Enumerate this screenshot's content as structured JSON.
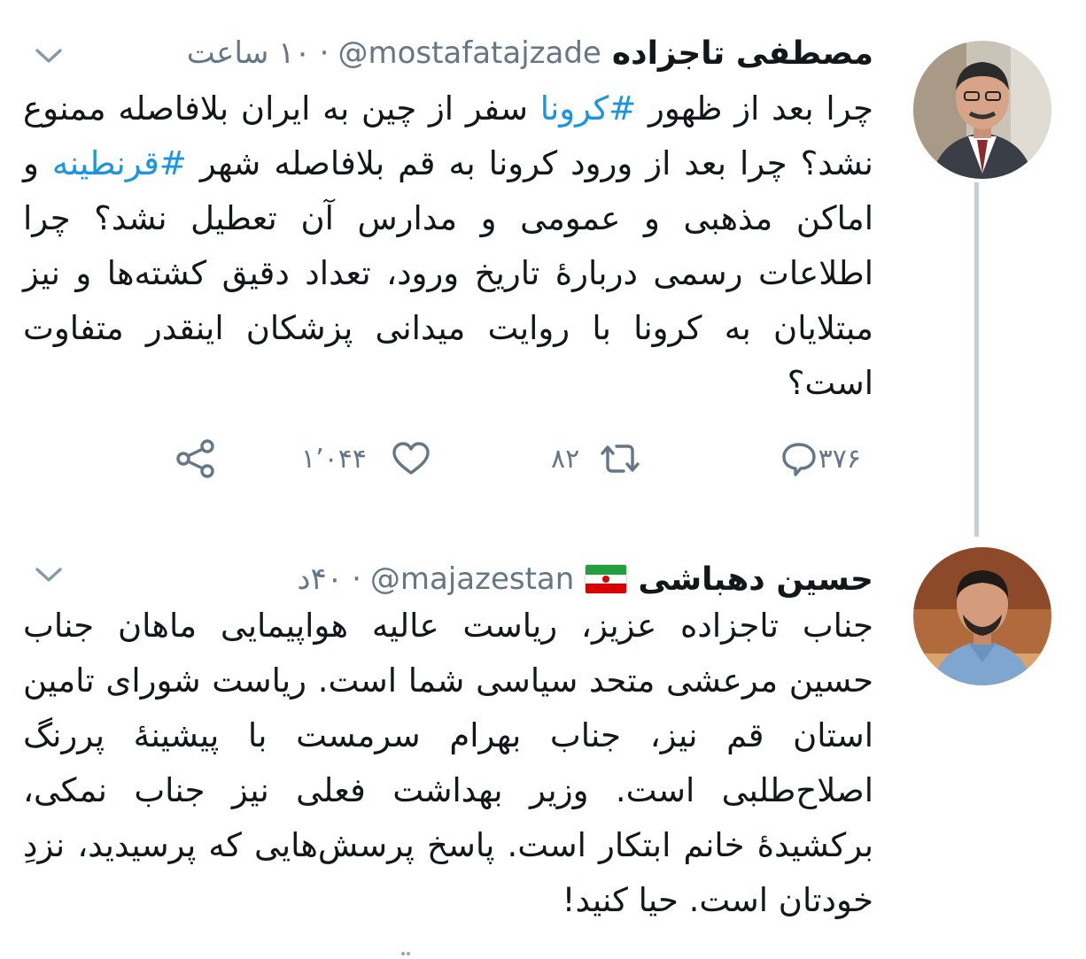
{
  "tweet1": {
    "name": "مصطفی تاجزاده",
    "handle": "@mostafatajzade",
    "dot": "·",
    "time": "۱۰ ساعت",
    "body": {
      "p1": "چرا بعد از ظهور ",
      "tag1": "#کرونا",
      "p2": " سفر از چین به ایران بلافاصله ممنوع نشد؟ چرا بعد از ورود کرونا به قم بلافاصله شهر ",
      "tag2": "#قرنطینه",
      "p3": " و اماکن مذهبی و عمومی و مدارس آن تعطیل نشد؟ چرا اطلاعات رسمی دربارهٔ تاریخ ورود، تعداد دقیق کشته‌ها و نیز مبتلایان به کرونا با روایت میدانی پزشکان اینقدر متفاوت است؟"
    },
    "actions": {
      "reply_count": "۳۷۶",
      "retweet_count": "۸۲",
      "like_count": "۱٬۰۴۴"
    }
  },
  "tweet2": {
    "name": "حسین دهباشی",
    "handle": "@majazestan",
    "dot": "·",
    "time": "۴۰د",
    "body": "جناب تاجزاده عزیز، ریاست عالیه هواپیمایی ماهان جناب حسین مرعشی متحد سیاسی شما است. ریاست شورای تامین استان قم نیز، جناب بهرام سرمست با پیشینهٔ پررنگ اصلاح‌طلبی است. وزیر بهداشت فعلی نیز جناب نمکی، برکشیدهٔ خانم ابتکار است. پاسخ پرسش‌هایی که پرسیدید، نزدِ خودتان است. حیا کنید!"
  },
  "colors": {
    "text": "#14171a",
    "secondary": "#657786",
    "hashtag": "#1b95e0",
    "thread_line": "#c4cfd6"
  },
  "icons": [
    "chevron-down-icon",
    "reply-icon",
    "retweet-icon",
    "like-icon",
    "share-icon",
    "iran-flag-icon"
  ]
}
